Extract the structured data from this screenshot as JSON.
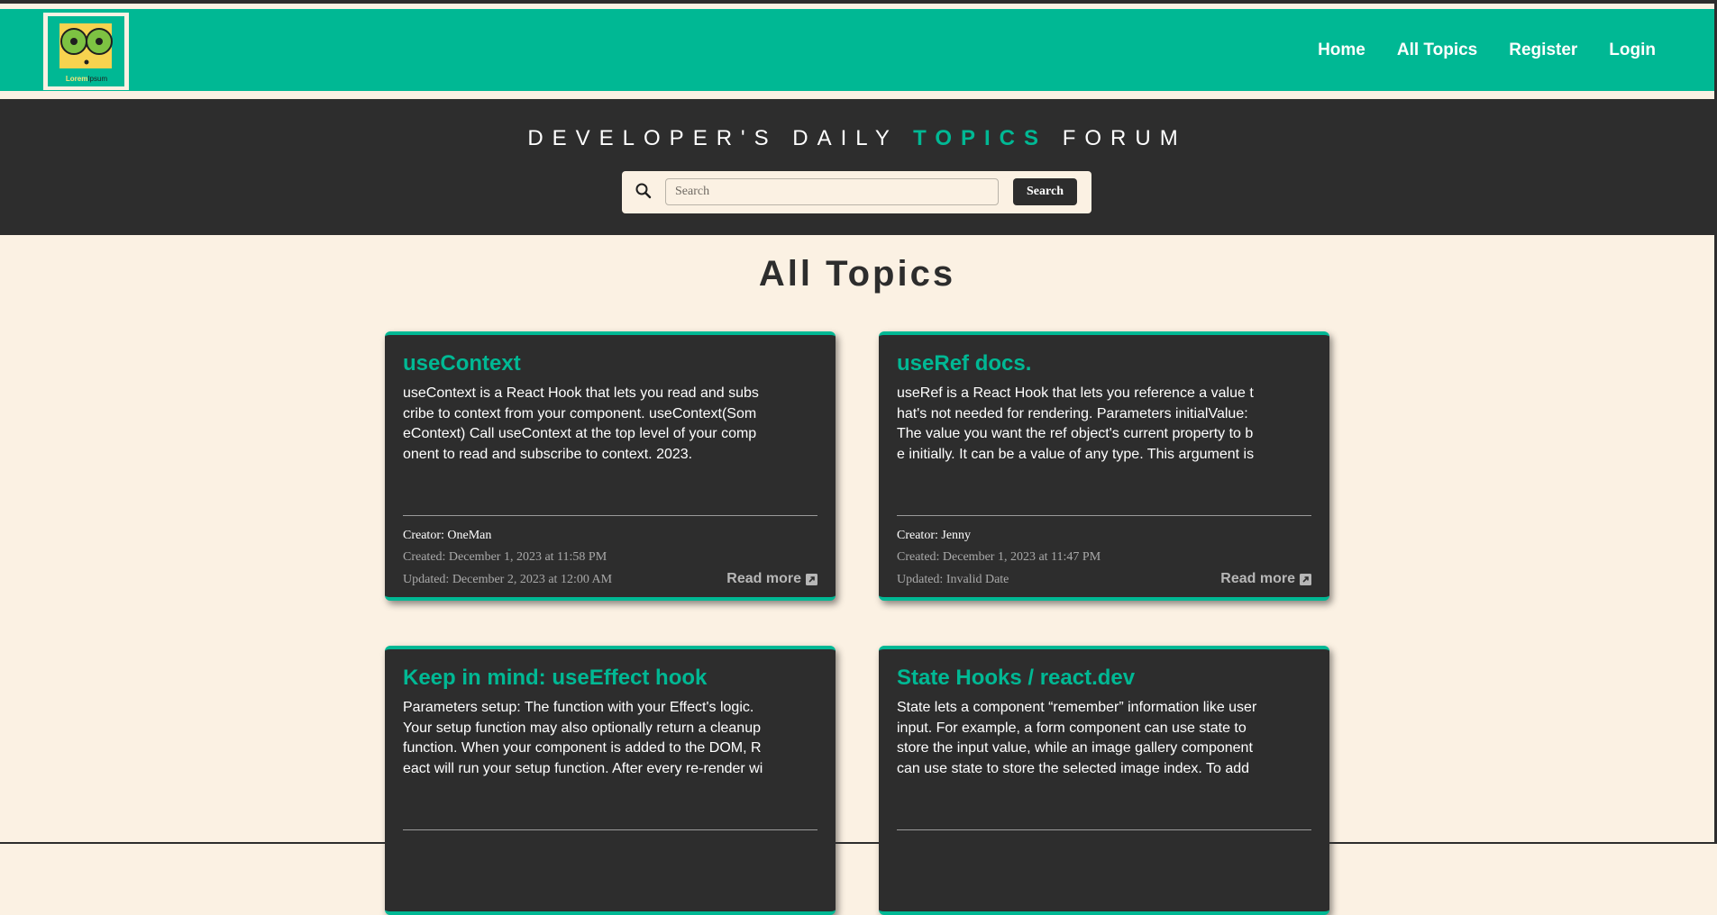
{
  "brand": {
    "logo_text_main": "Lorem",
    "logo_text_sub": "Ipsum",
    "colors": {
      "accent": "#00b894",
      "dark": "#2d2d2d",
      "cream": "#fbf1e3"
    }
  },
  "nav": {
    "items": [
      {
        "label": "Home"
      },
      {
        "label": "All Topics"
      },
      {
        "label": "Register"
      },
      {
        "label": "Login"
      }
    ]
  },
  "hero": {
    "title_part1": "DEVELOPER'S DAILY",
    "title_accent": "TOPICS",
    "title_part2": "FORUM",
    "search_placeholder": "Search",
    "search_button": "Search",
    "search_icon": "search-icon"
  },
  "page": {
    "heading": "All Topics"
  },
  "topics": [
    {
      "title": "useContext",
      "excerpt": "useContext is a React Hook that lets you read and subscribe to context from your component. useContext(SomeContext) Call useContext at the top level of your component to read and subscribe to context. 2023.",
      "creator": "Creator: OneMan",
      "created": "Created: December 1, 2023 at 11:58 PM",
      "updated": "Updated: December 2, 2023 at 12:00 AM",
      "read_more": "Read more"
    },
    {
      "title": "useRef docs.",
      "excerpt": "useRef is a React Hook that lets you reference a value that's not needed for rendering. Parameters initialValue: The value you want the ref object's current property to be initially. It can be a value of any type. This argument is",
      "creator": "Creator: Jenny",
      "created": "Created: December 1, 2023 at 11:47 PM",
      "updated": "Updated: Invalid Date",
      "read_more": "Read more"
    },
    {
      "title": "Keep in mind: useEffect hook",
      "excerpt": "Parameters setup: The function with your Effect's logic. Your setup function may also optionally return a cleanup function. When your component is added to the DOM, React will run your setup function. After every re-render wi",
      "creator": "",
      "created": "",
      "updated": "",
      "read_more": ""
    },
    {
      "title": "State Hooks / react.dev",
      "excerpt": "State lets a component “remember” information like user input. For example, a form component can use state to store the input value, while an image gallery component can use state to store the selected image index. To add",
      "creator": "",
      "created": "",
      "updated": "",
      "read_more": ""
    }
  ]
}
